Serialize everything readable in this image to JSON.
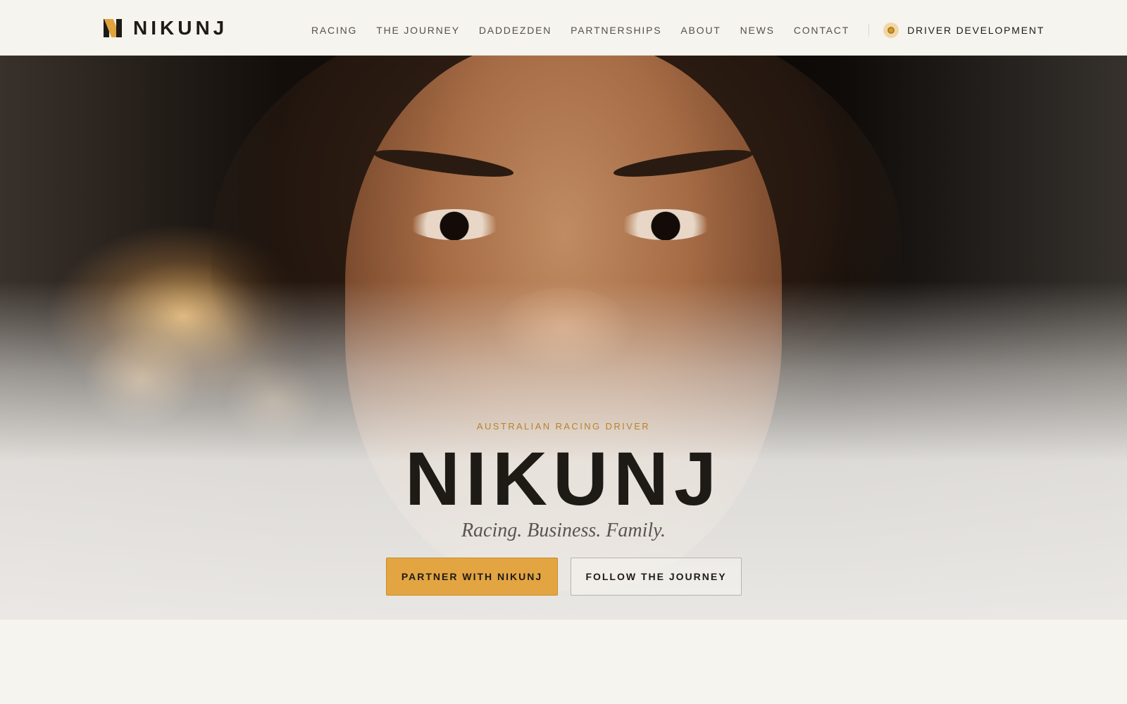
{
  "brand": {
    "name": "NIKUNJ",
    "accent": "#e2a541",
    "dark": "#1e1b17"
  },
  "nav": {
    "items": [
      {
        "label": "RACING"
      },
      {
        "label": "THE JOURNEY"
      },
      {
        "label": "DADDEZDEN"
      },
      {
        "label": "PARTNERSHIPS"
      },
      {
        "label": "ABOUT"
      },
      {
        "label": "NEWS"
      },
      {
        "label": "CONTACT"
      }
    ],
    "cta": {
      "label": "DRIVER DEVELOPMENT",
      "icon": "target-icon"
    }
  },
  "hero": {
    "eyebrow": "AUSTRALIAN RACING DRIVER",
    "title": "NIKUNJ",
    "tagline": "Racing. Business. Family.",
    "primary_button": "PARTNER WITH NIKUNJ",
    "secondary_button": "FOLLOW THE JOURNEY"
  }
}
